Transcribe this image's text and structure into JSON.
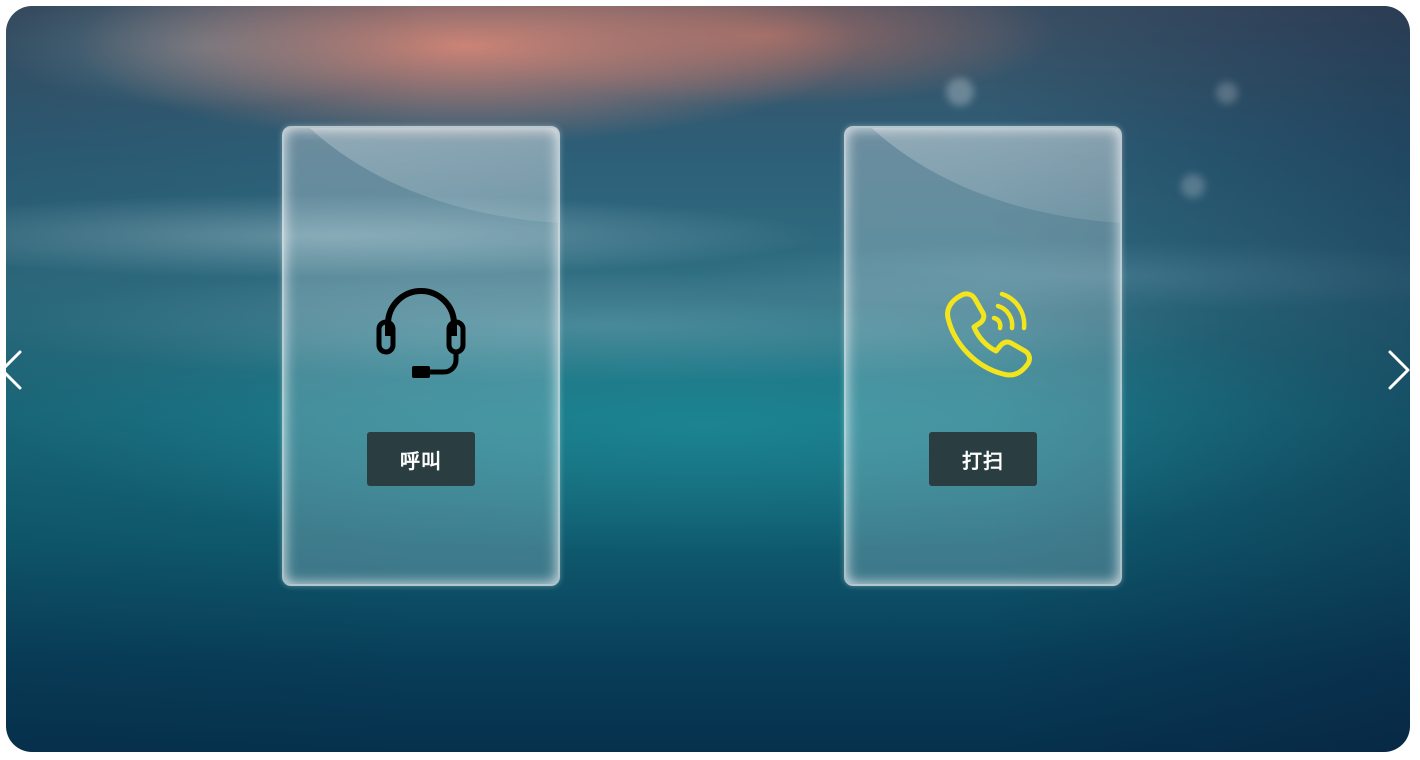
{
  "cards": [
    {
      "icon": "headset-icon",
      "icon_color": "#000000",
      "button_label": "呼叫"
    },
    {
      "icon": "phone-ringing-icon",
      "icon_color": "#f2e51e",
      "button_label": "打扫"
    }
  ],
  "navigation": {
    "prev_icon": "chevron-left-icon",
    "next_icon": "chevron-right-icon"
  },
  "colors": {
    "button_bg": "#2a3d40",
    "button_text": "#ffffff",
    "accent_yellow": "#f2e51e"
  }
}
